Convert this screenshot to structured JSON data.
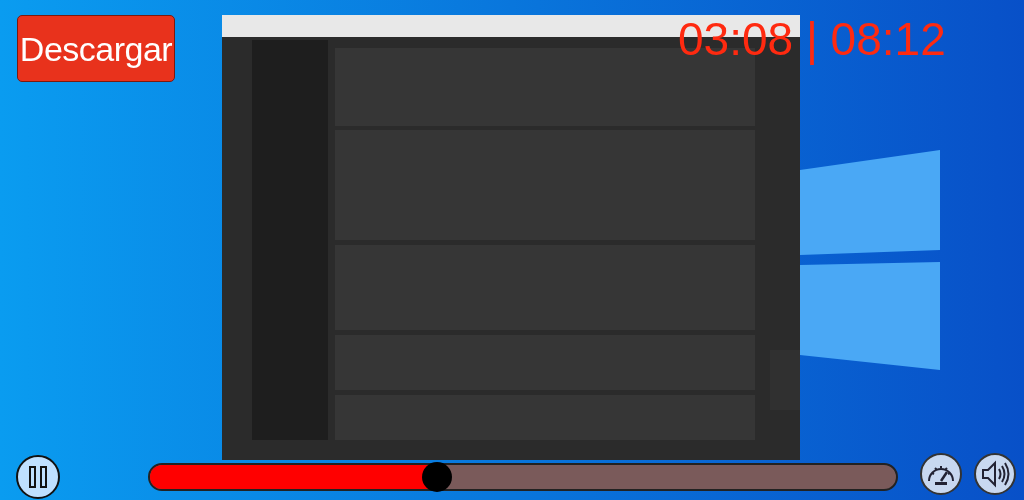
{
  "download_button": {
    "label": "Descargar"
  },
  "time": "03:08 | 08:12",
  "controls": {
    "playing": true,
    "progress": {
      "level": 0.385
    }
  }
}
